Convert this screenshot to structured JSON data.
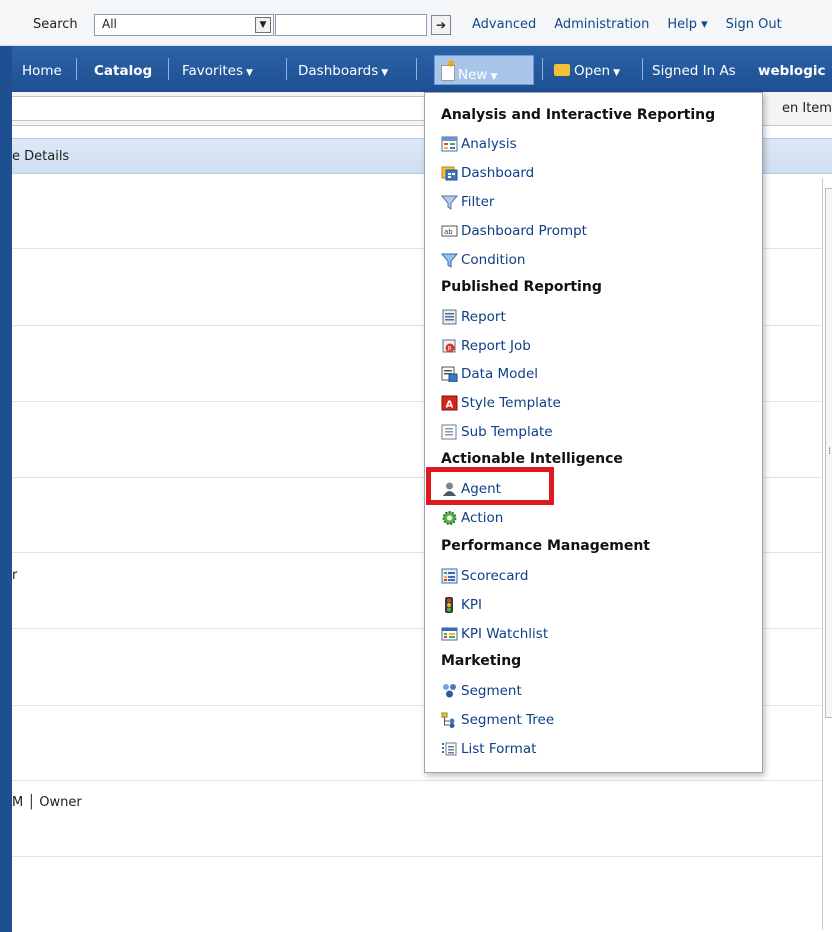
{
  "search": {
    "label": "Search",
    "scope_value": "All",
    "go_icon": "arrow-right-icon",
    "links": [
      "Advanced",
      "Administration",
      "Help ▾",
      "Sign Out"
    ]
  },
  "nav": {
    "home": "Home",
    "catalog": "Catalog",
    "favorites": "Favorites",
    "dashboards": "Dashboards",
    "new": "New",
    "open": "Open",
    "signed_in_as": "Signed In As",
    "user": "weblogic"
  },
  "subbar": {
    "open_items": "en Items"
  },
  "header": {
    "details": "e Details"
  },
  "rows": {
    "row1": "r",
    "row2": "M │ Owner"
  },
  "menu": {
    "sections": [
      {
        "title": "Analysis and Interactive Reporting",
        "items": [
          {
            "label": "Analysis",
            "icon": "analysis-icon"
          },
          {
            "label": "Dashboard",
            "icon": "dashboard-icon"
          },
          {
            "label": "Filter",
            "icon": "filter-icon"
          },
          {
            "label": "Dashboard Prompt",
            "icon": "prompt-icon"
          },
          {
            "label": "Condition",
            "icon": "condition-icon"
          }
        ]
      },
      {
        "title": "Published Reporting",
        "items": [
          {
            "label": "Report",
            "icon": "report-icon"
          },
          {
            "label": "Report Job",
            "icon": "report-job-icon"
          },
          {
            "label": "Data Model",
            "icon": "data-model-icon"
          },
          {
            "label": "Style Template",
            "icon": "style-template-icon"
          },
          {
            "label": "Sub Template",
            "icon": "sub-template-icon"
          }
        ]
      },
      {
        "title": "Actionable Intelligence",
        "items": [
          {
            "label": "Agent",
            "icon": "agent-icon"
          },
          {
            "label": "Action",
            "icon": "action-gear-icon"
          }
        ]
      },
      {
        "title": "Performance Management",
        "items": [
          {
            "label": "Scorecard",
            "icon": "scorecard-icon"
          },
          {
            "label": "KPI",
            "icon": "kpi-traffic-light-icon"
          },
          {
            "label": "KPI Watchlist",
            "icon": "kpi-watchlist-icon"
          }
        ]
      },
      {
        "title": "Marketing",
        "items": [
          {
            "label": "Segment",
            "icon": "segment-icon"
          },
          {
            "label": "Segment Tree",
            "icon": "segment-tree-icon"
          },
          {
            "label": "List Format",
            "icon": "list-format-icon"
          }
        ]
      }
    ]
  },
  "colors": {
    "nav_blue": "#1e4f91",
    "link_blue": "#124a88",
    "highlight_red": "#e0191f"
  }
}
